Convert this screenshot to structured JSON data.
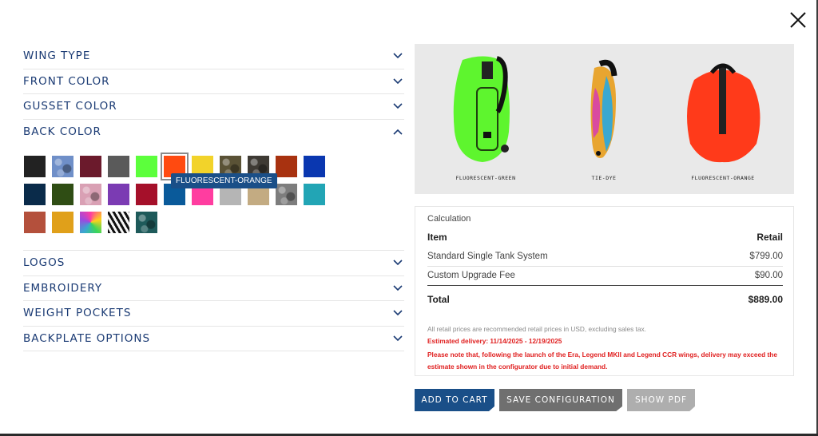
{
  "accordion_top": [
    {
      "label": "WING TYPE",
      "open": false
    },
    {
      "label": "FRONT COLOR",
      "open": false
    },
    {
      "label": "GUSSET COLOR",
      "open": false
    },
    {
      "label": "BACK COLOR",
      "open": true
    }
  ],
  "accordion_bottom": [
    {
      "label": "LOGOS",
      "open": false
    },
    {
      "label": "EMBROIDERY",
      "open": false
    },
    {
      "label": "WEIGHT POCKETS",
      "open": false
    },
    {
      "label": "BACKPLATE OPTIONS",
      "open": false
    }
  ],
  "back_color": {
    "tooltip": "FLUORESCENT-ORANGE",
    "selected_index": 5,
    "swatch_colors": [
      "#222222",
      "#6f8fc8",
      "#6b1a2c",
      "#5a5a5a",
      "#5cff3c",
      "#ff4a10",
      "#f2d32a",
      "#5a5236",
      "#3e3a34",
      "#a83210",
      "#0a37b0",
      "#0a2b4a",
      "#2f4d14",
      "#d9a0b4",
      "#7b3bb3",
      "#a5102a",
      "#0a5a9a",
      "#ff3da0",
      "#b5b5b5",
      "#c3ab82",
      "#7d7d7d",
      "#22a5b5",
      "#b4503c",
      "#e0a01a",
      "#d85ad0",
      "#f0f0f0",
      "#1e5a5a"
    ],
    "swatch_patterns": [
      "solid",
      "camo-blue",
      "solid",
      "solid",
      "solid",
      "solid",
      "solid",
      "camo",
      "camo-dark",
      "solid",
      "solid",
      "solid",
      "solid",
      "camo-pink",
      "solid",
      "solid",
      "solid",
      "solid",
      "solid",
      "solid",
      "camo-grey",
      "solid",
      "solid",
      "solid",
      "tie-dye",
      "zebra",
      "camo-teal"
    ]
  },
  "product": {
    "labels": [
      "FLUORESCENT-GREEN",
      "TIE-DYE",
      "FLUORESCENT-ORANGE"
    ],
    "colors": {
      "green": "#5ef52e",
      "orange": "#ff3a1a"
    }
  },
  "calculation": {
    "title": "Calculation",
    "col_item": "Item",
    "col_retail": "Retail",
    "rows": [
      {
        "item": "Standard Single Tank System",
        "price": "$799.00"
      },
      {
        "item": "Custom Upgrade Fee",
        "price": "$90.00"
      }
    ],
    "total_label": "Total",
    "total_value": "$889.00",
    "note_retail": "All retail prices are recommended retail prices in USD, excluding sales tax.",
    "note_delivery": "Estimated delivery: 11/14/2025 - 12/19/2025",
    "note_warning": "Please note that, following the launch of the Era, Legend MKII and Legend CCR wings, delivery may exceed the estimate shown in the configurator due to initial demand."
  },
  "buttons": {
    "add_to_cart": "ADD TO CART",
    "save_configuration": "SAVE CONFIGURATION",
    "show_pdf": "SHOW PDF"
  },
  "colors": {
    "accent": "#1a4f88",
    "heading": "#1b3b74",
    "warning": "#e02020"
  }
}
